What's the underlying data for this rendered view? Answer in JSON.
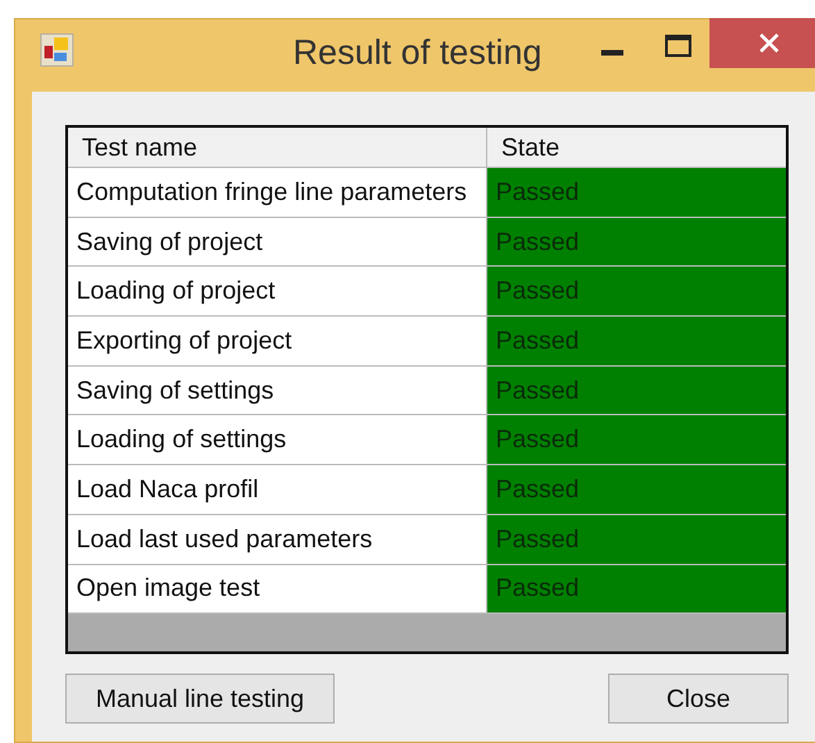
{
  "window": {
    "title": "Result of testing"
  },
  "table": {
    "columns": [
      "Test name",
      "State"
    ],
    "rows": [
      {
        "name": "Computation fringe line parameters",
        "state": "Passed",
        "color": "#008000"
      },
      {
        "name": "Saving of project",
        "state": "Passed",
        "color": "#008000"
      },
      {
        "name": "Loading of project",
        "state": "Passed",
        "color": "#008000"
      },
      {
        "name": "Exporting of project",
        "state": "Passed",
        "color": "#008000"
      },
      {
        "name": "Saving of settings",
        "state": "Passed",
        "color": "#008000"
      },
      {
        "name": "Loading of settings",
        "state": "Passed",
        "color": "#008000"
      },
      {
        "name": "Load Naca profil",
        "state": "Passed",
        "color": "#008000"
      },
      {
        "name": "Load last used parameters",
        "state": "Passed",
        "color": "#008000"
      },
      {
        "name": "Open image test",
        "state": "Passed",
        "color": "#008000"
      }
    ]
  },
  "buttons": [
    "Manual line testing",
    "Close"
  ]
}
